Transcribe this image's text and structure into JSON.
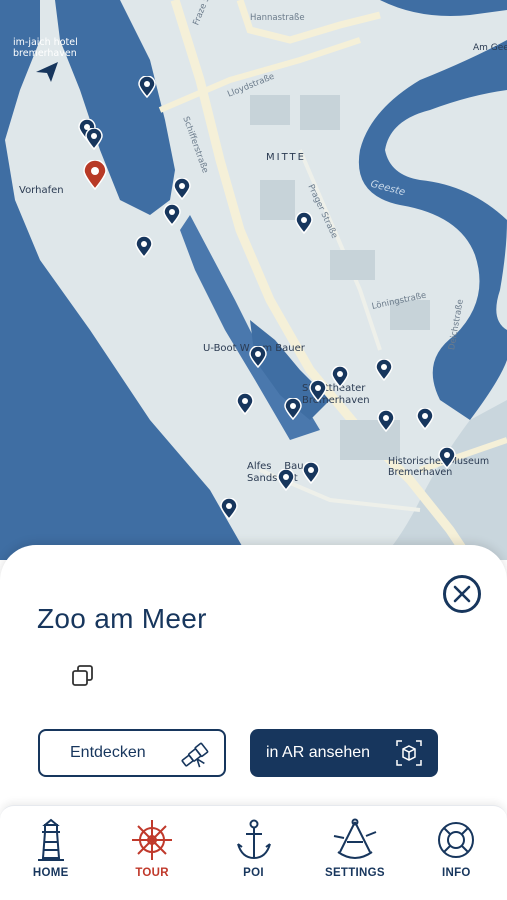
{
  "map": {
    "labels": {
      "hotel": "im-jaich hotel\nbremerhaven",
      "vorhafen": "Vorhafen",
      "mitte": "MITTE",
      "geeste": "Geeste",
      "uboot": "U-Boot W    m Bauer",
      "stadttheater": "Stadttheater\nBremerhaven",
      "alfes": "Alfes    Bauer\nSandstedt",
      "museum": "Historisches Museum\nBremerhaven",
      "am_gees": "Am Gees"
    },
    "streets": {
      "hannastrasse": "Hannastraße",
      "lloydstrasse": "Lloydstraße",
      "schifferstrasse": "Schifferstraße",
      "pragerstrasse": "Prager Straße",
      "loeningstrasse": "Löningstraße",
      "deichstrasse": "Deichstraße",
      "frazerstrasse": "Fraze Straße"
    },
    "pin_color": "#17365d",
    "selected_pin_color": "#b83a26"
  },
  "sheet": {
    "title": "Zoo am Meer",
    "discover_label": "Entdecken",
    "ar_label": "in AR ansehen"
  },
  "tabs": [
    {
      "label": "HOME",
      "icon": "lighthouse-icon",
      "active": false
    },
    {
      "label": "TOUR",
      "icon": "ship-wheel-icon",
      "active": true
    },
    {
      "label": "POI",
      "icon": "anchor-icon",
      "active": false
    },
    {
      "label": "SETTINGS",
      "icon": "sextant-icon",
      "active": false
    },
    {
      "label": "INFO",
      "icon": "lifebuoy-icon",
      "active": false
    }
  ],
  "colors": {
    "primary": "#17365d",
    "accent": "#c0392b",
    "water": "#3f6ea3",
    "land": "#dfe7ea"
  }
}
